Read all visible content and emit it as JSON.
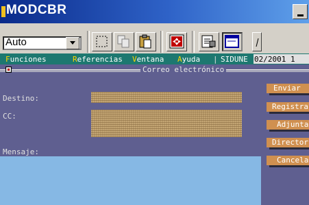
{
  "window": {
    "title": "MODCBR"
  },
  "toolbar": {
    "combo_value": "Auto"
  },
  "menu": {
    "items": [
      {
        "label": "Funciones",
        "hotkey": "F"
      },
      {
        "label": "Referencias",
        "hotkey": "R"
      },
      {
        "label": "Ventana",
        "hotkey": "V"
      },
      {
        "label": "Ayuda",
        "hotkey": "A"
      }
    ],
    "system": "SIDUNE",
    "date": "02/2001 1"
  },
  "form": {
    "title": "Correo electrónico",
    "destino_label": "Destino:",
    "cc_label": "CC:",
    "mensaje_label": "Mensaje:"
  },
  "buttons": {
    "enviar": "Enviar",
    "registrar": "Registra",
    "adjuntar": "Adjunta",
    "directorio": "Director",
    "cancelar": "Cancela"
  },
  "colors": {
    "background": "#5f5f90",
    "menubar": "#1d7870",
    "button": "#d09050",
    "message_area": "#86b8e4"
  }
}
